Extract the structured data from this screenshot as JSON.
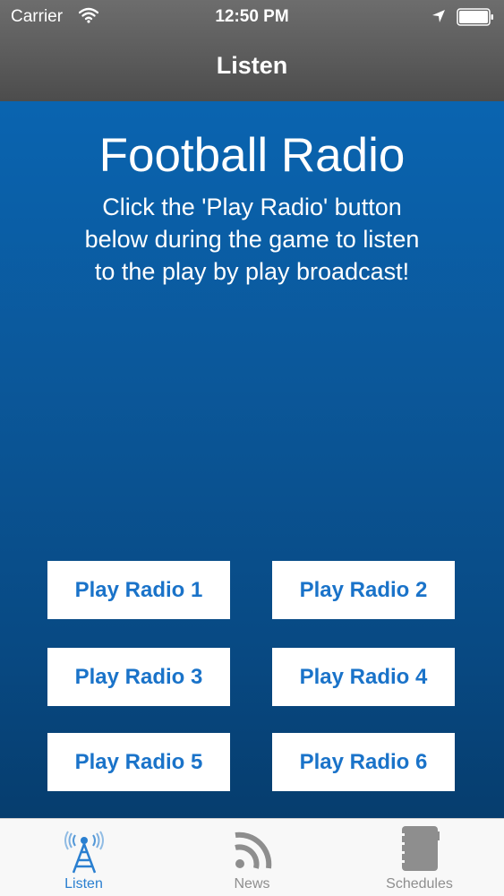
{
  "status_bar": {
    "carrier": "Carrier",
    "time": "12:50 PM"
  },
  "nav": {
    "title": "Listen"
  },
  "main": {
    "title": "Football Radio",
    "description": "Click the 'Play Radio' button below during the game to listen to the play by play broadcast!",
    "buttons": [
      {
        "label": "Play Radio 1"
      },
      {
        "label": "Play Radio 2"
      },
      {
        "label": "Play Radio 3"
      },
      {
        "label": "Play Radio 4"
      },
      {
        "label": "Play Radio 5"
      },
      {
        "label": "Play Radio 6"
      }
    ]
  },
  "tabs": [
    {
      "label": "Listen",
      "icon": "radio-tower-icon",
      "active": true
    },
    {
      "label": "News",
      "icon": "rss-feed-icon",
      "active": false
    },
    {
      "label": "Schedules",
      "icon": "notebook-icon",
      "active": false
    }
  ],
  "colors": {
    "accent": "#2a7fd0",
    "button_text": "#1a73c9",
    "background": "#0a5799",
    "inactive_tab": "#8e8e8e"
  }
}
